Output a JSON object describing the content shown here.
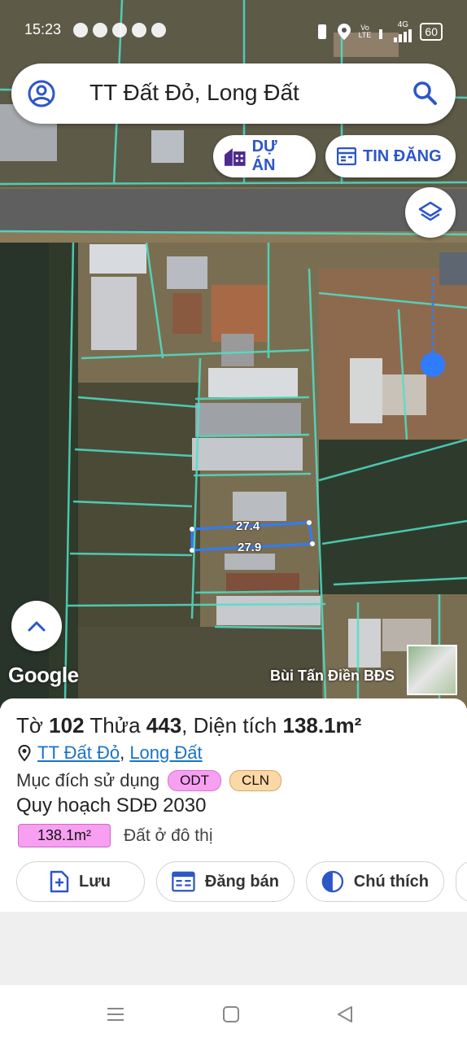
{
  "status_bar": {
    "time": "15:23",
    "notification_icons": [
      "messenger-icon",
      "tiktok-icon",
      "tiktok-icon",
      "tiktok-icon",
      "app-icon"
    ],
    "network_label": "4G",
    "volte_label": "Vo\nLTE",
    "battery": "60"
  },
  "search": {
    "title": "TT Đất Đỏ, Long Đất"
  },
  "chips": {
    "du_an": "DỰ ÁN",
    "tin_dang": "TIN ĐĂNG"
  },
  "map": {
    "measure_top": "27.4",
    "measure_bottom": "27.9",
    "google_logo": "Google",
    "watermark": "Bùi Tấn Điền BĐS",
    "colors": {
      "parcel_line": "#4fe0c8",
      "selected_parcel": "#2f7cff",
      "location_dot": "#2f7cff"
    }
  },
  "parcel": {
    "to_label": "Tờ",
    "to_value": "102",
    "thua_label": "Thửa",
    "thua_value": "443",
    "dien_tich_label": "Diện tích",
    "dien_tich_value": "138.1m²",
    "location_part1": "TT Đất Đỏ",
    "location_sep": ",",
    "location_part2": "Long Đất",
    "purpose_label": "Mục đích sử dụng",
    "purpose_badges": [
      "ODT",
      "CLN"
    ],
    "plan_label": "Quy hoạch SDĐ 2030",
    "area_badge": "138.1m²",
    "area_desc": "Đất ở đô thị"
  },
  "actions": {
    "save": "Lưu",
    "sell": "Đăng bán",
    "legend": "Chú thích"
  }
}
